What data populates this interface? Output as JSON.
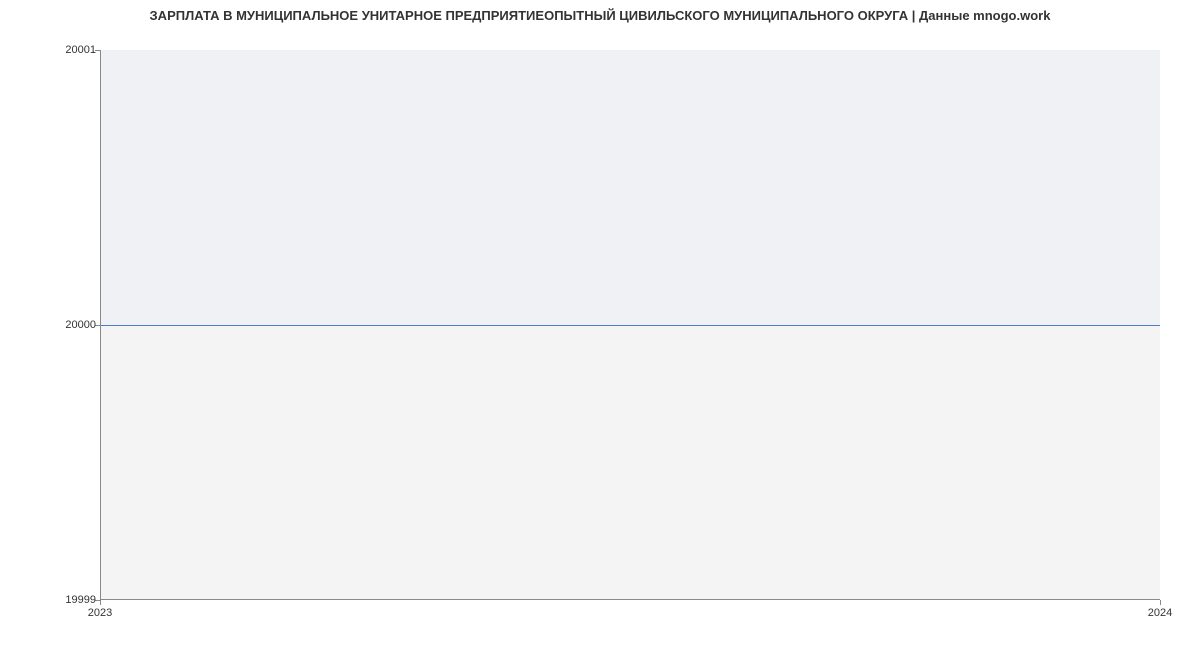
{
  "chart_data": {
    "type": "area",
    "title": "ЗАРПЛАТА В МУНИЦИПАЛЬНОЕ УНИТАРНОЕ ПРЕДПРИЯТИЕОПЫТНЫЙ ЦИВИЛЬСКОГО МУНИЦИПАЛЬНОГО ОКРУГА | Данные mnogo.work",
    "xlabel": "",
    "ylabel": "",
    "x": [
      "2023",
      "2024"
    ],
    "values": [
      20000,
      20000
    ],
    "ylim": [
      19999,
      20001
    ],
    "yticks": [
      {
        "label": "19999",
        "value": 19999
      },
      {
        "label": "20000",
        "value": 20000
      },
      {
        "label": "20001",
        "value": 20001
      }
    ],
    "xticks": [
      {
        "label": "2023",
        "value": 2023
      },
      {
        "label": "2024",
        "value": 2024
      }
    ],
    "series_color": "#4a7ec8",
    "fill_color": "#e8ecf5"
  }
}
